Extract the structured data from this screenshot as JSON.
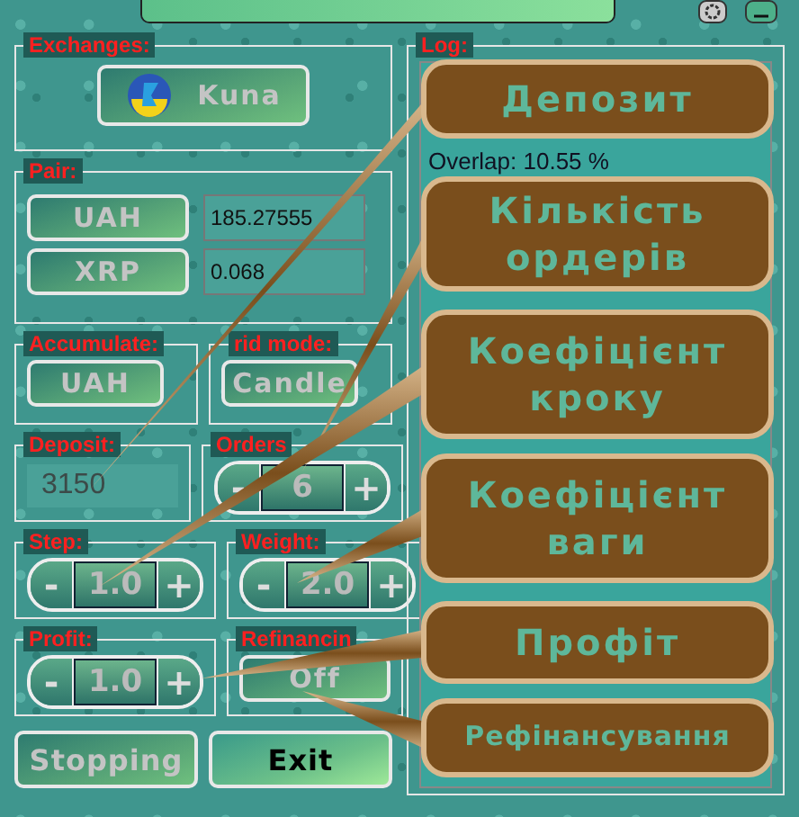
{
  "progress": {
    "level": 1
  },
  "exchanges": {
    "label": "Exchanges:",
    "button": "Kuna"
  },
  "pair": {
    "label": "Pair:",
    "rows": [
      {
        "currency": "UAH",
        "value": "185.27555"
      },
      {
        "currency": "XRP",
        "value": "0.068"
      }
    ]
  },
  "accumulate": {
    "label": "Accumulate:",
    "button": "UAH"
  },
  "grid_mode": {
    "label": "rid mode:",
    "button": "Candle"
  },
  "deposit": {
    "label": "Deposit:",
    "value": "3150",
    "disabled": true
  },
  "orders": {
    "label": "Orders",
    "minus": "-",
    "value": "6",
    "plus": "+"
  },
  "step": {
    "label": "Step:",
    "minus": "-",
    "value": "1.0",
    "plus": "+"
  },
  "weight": {
    "label": "Weight:",
    "minus": "-",
    "value": "2.0",
    "plus": "+"
  },
  "profit": {
    "label": "Profit:",
    "minus": "-",
    "value": "1.0",
    "plus": "+"
  },
  "refinancing": {
    "label": "Refinancin",
    "button": "Off"
  },
  "buttons": [
    {
      "label": "Stopping",
      "disabled": true
    },
    {
      "label": "Exit",
      "disabled": false
    }
  ],
  "log": {
    "label": "Log:",
    "lines": [
      "Overlap: 10.55 %"
    ]
  },
  "callouts": [
    {
      "text": "Депозит"
    },
    {
      "text": "Кількість ордерів"
    },
    {
      "text": "Коефіцієнт кроку"
    },
    {
      "text": "Коефіцієнт ваги"
    },
    {
      "text": "Профіт"
    },
    {
      "text": "Рефінансування"
    }
  ]
}
